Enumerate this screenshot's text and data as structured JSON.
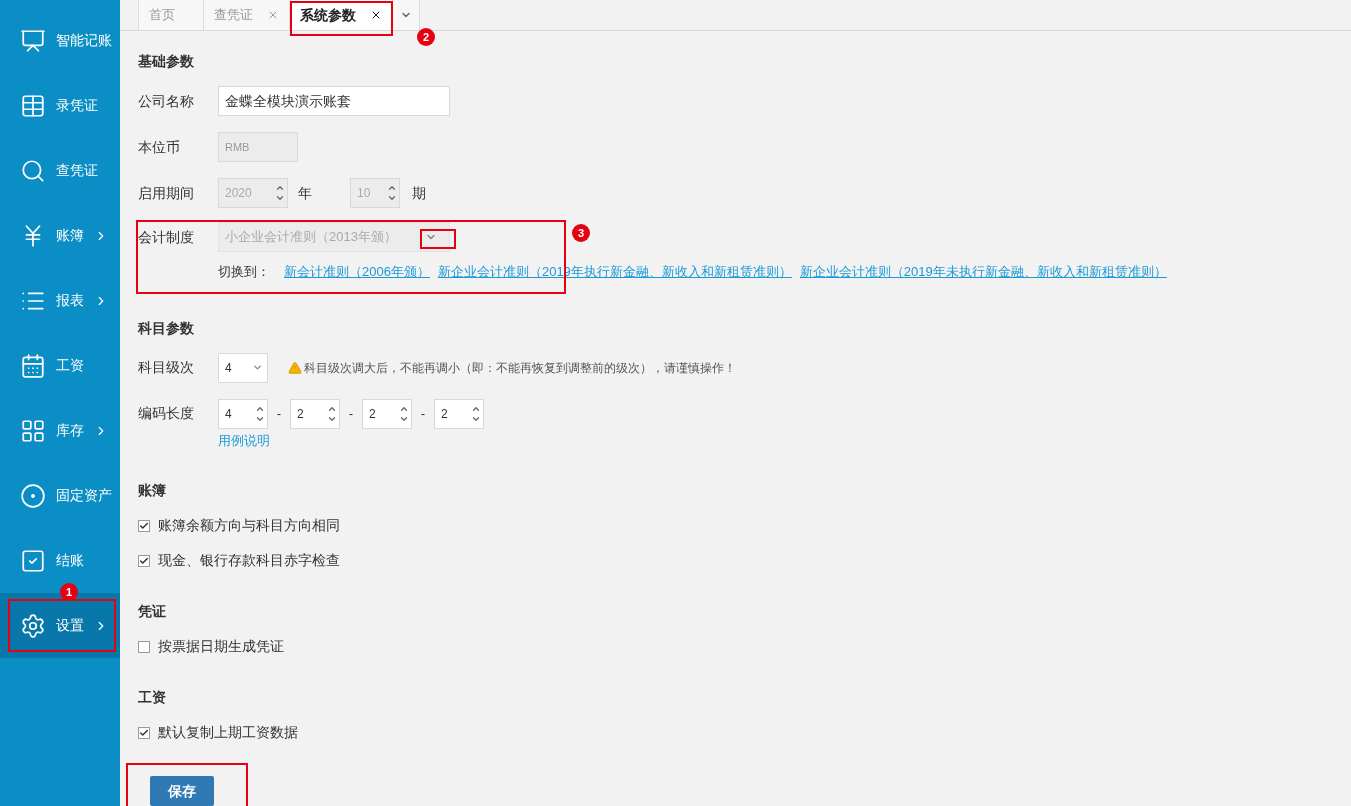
{
  "sidebar": {
    "items": [
      {
        "label": "智能记账",
        "expandable": false,
        "selected": false
      },
      {
        "label": "录凭证",
        "expandable": false,
        "selected": false
      },
      {
        "label": "查凭证",
        "expandable": false,
        "selected": false
      },
      {
        "label": "账簿",
        "expandable": true,
        "selected": false
      },
      {
        "label": "报表",
        "expandable": true,
        "selected": false
      },
      {
        "label": "工资",
        "expandable": false,
        "selected": false
      },
      {
        "label": "库存",
        "expandable": true,
        "selected": false
      },
      {
        "label": "固定资产",
        "expandable": false,
        "selected": false
      },
      {
        "label": "结账",
        "expandable": false,
        "selected": false
      },
      {
        "label": "设置",
        "expandable": true,
        "selected": true,
        "badge": "1"
      }
    ]
  },
  "tabs": [
    {
      "label": "首页",
      "closable": false,
      "selected": false
    },
    {
      "label": "查凭证",
      "closable": true,
      "selected": false
    },
    {
      "label": "系统参数",
      "closable": true,
      "selected": true,
      "badge": "2"
    }
  ],
  "basic": {
    "title": "基础参数",
    "company": {
      "label": "公司名称",
      "value": "金蝶全模块演示账套"
    },
    "currency": {
      "label": "本位币",
      "value": "RMB"
    },
    "period": {
      "label": "启用期间",
      "year": "2020",
      "year_unit": "年",
      "month": "10",
      "month_unit": "期"
    },
    "standard": {
      "label": "会计制度",
      "value": "小企业会计准则（2013年颁）",
      "badge": "3",
      "switch_label": "切换到：",
      "links": [
        "新会计准则（2006年颁）",
        "新企业会计准则（2019年执行新金融、新收入和新租赁准则）",
        "新企业会计准则（2019年未执行新金融、新收入和新租赁准则）"
      ]
    }
  },
  "account": {
    "title": "科目参数",
    "levels": {
      "label": "科目级次",
      "value": "4",
      "warning": "科目级次调大后，不能再调小（即：不能再恢复到调整前的级次），请谨慎操作！"
    },
    "code_length": {
      "label": "编码长度",
      "values": [
        "4",
        "2",
        "2",
        "2"
      ],
      "separator": "-",
      "help_link": "用例说明"
    }
  },
  "sections": [
    {
      "title": "账簿",
      "options": [
        {
          "label": "账簿余额方向与科目方向相同",
          "checked": true
        },
        {
          "label": "现金、银行存款科目赤字检查",
          "checked": true
        }
      ]
    },
    {
      "title": "凭证",
      "options": [
        {
          "label": "按票据日期生成凭证",
          "checked": false
        }
      ]
    },
    {
      "title": "工资",
      "options": [
        {
          "label": "默认复制上期工资数据",
          "checked": true
        }
      ]
    }
  ],
  "save_button": "保存"
}
